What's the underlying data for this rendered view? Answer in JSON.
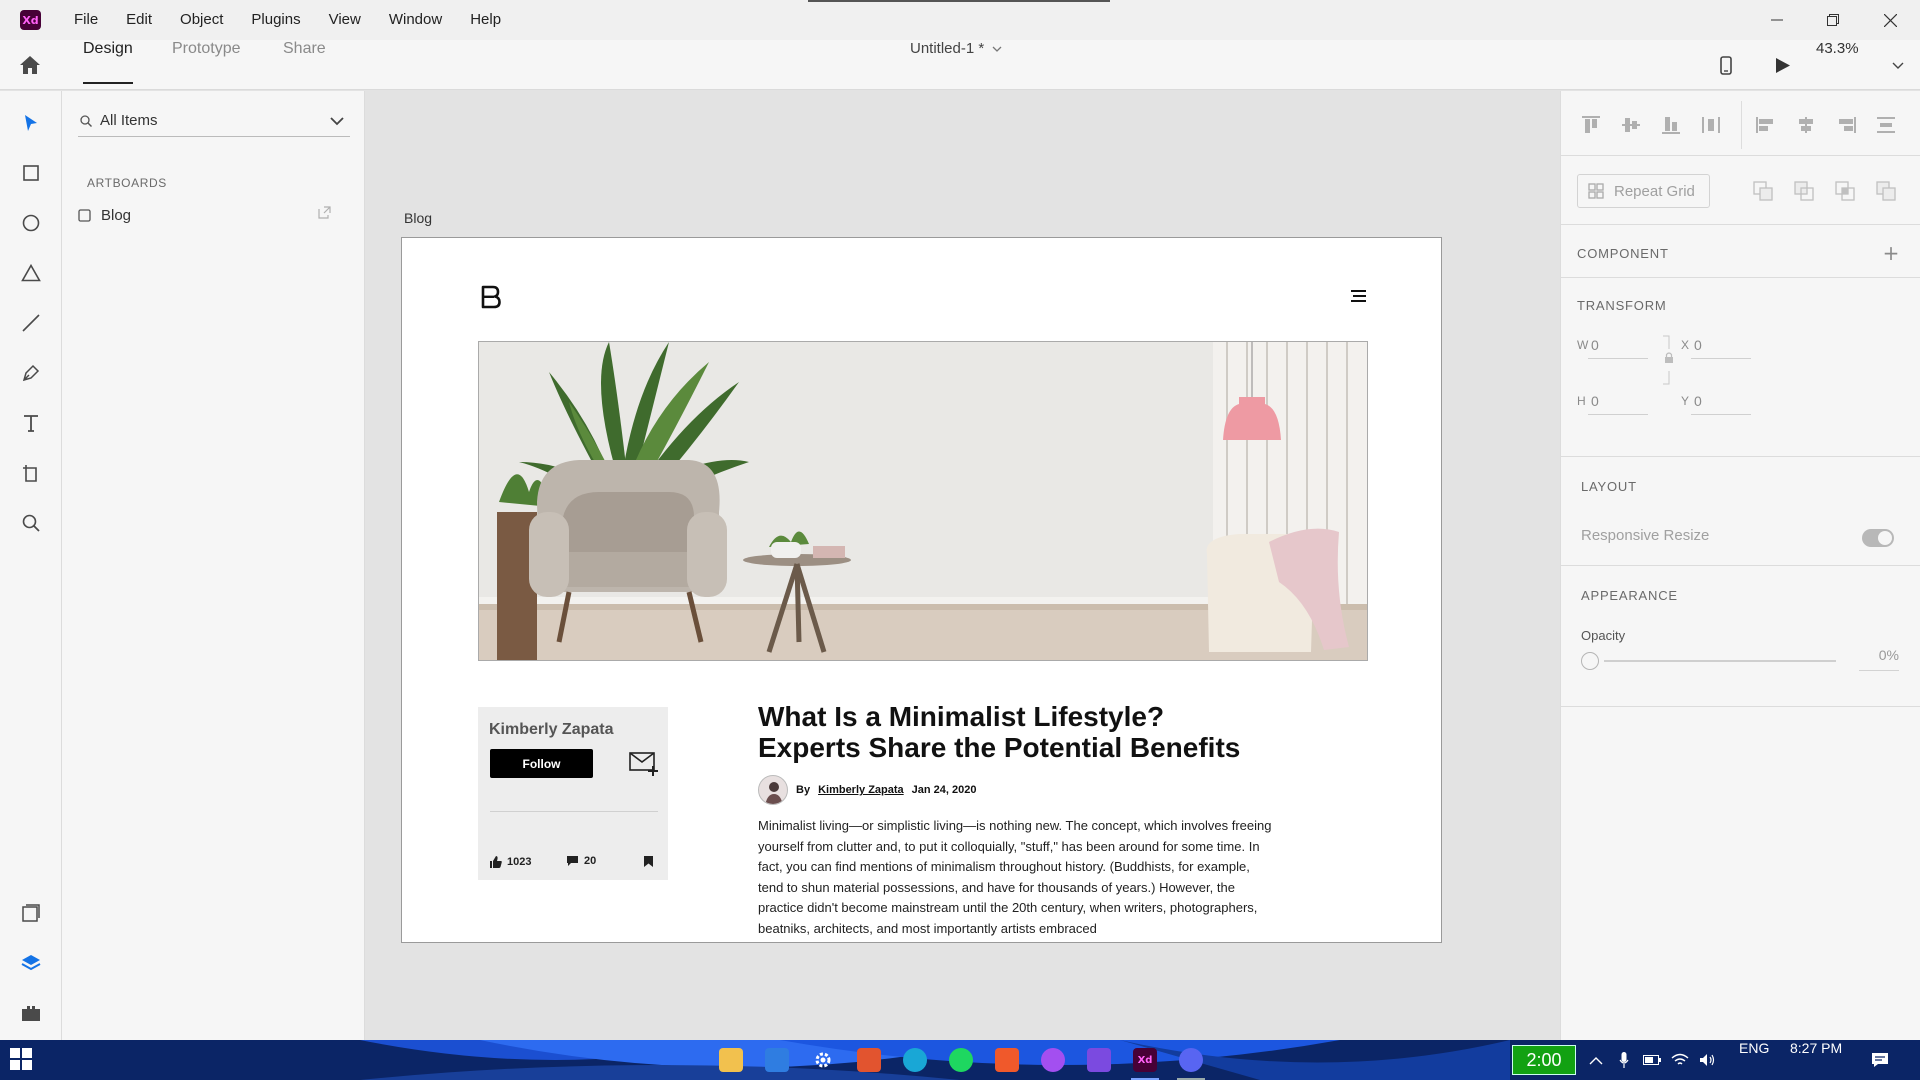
{
  "app": {
    "logo_text": "Xd",
    "brand_color": "#470137"
  },
  "menu": [
    "File",
    "Edit",
    "Object",
    "Plugins",
    "View",
    "Window",
    "Help"
  ],
  "modes": {
    "design": "Design",
    "prototype": "Prototype",
    "share": "Share"
  },
  "document": {
    "title": "Untitled-1 *",
    "zoom": "43.3%"
  },
  "layers": {
    "search_label": "All Items",
    "section": "ARTBOARDS",
    "artboards": [
      {
        "label": "Blog"
      }
    ]
  },
  "artboard": {
    "name": "Blog",
    "author_card": {
      "name": "Kimberly Zapata",
      "follow_label": "Follow",
      "likes": "1023",
      "comments": "20"
    },
    "article": {
      "headline_line1": "What Is a Minimalist Lifestyle?",
      "headline_line2": "Experts Share the Potential Benefits",
      "by": "By",
      "author": "Kimberly Zapata",
      "date": "Jan 24, 2020",
      "body": "Minimalist living—or simplistic living—is nothing new. The concept, which involves freeing yourself from clutter and, to put it colloquially, \"stuff,\" has been around for some time. In fact, you can find mentions of minimalism throughout history. (Buddhists, for example, tend to shun material possessions, and have for thousands of years.) However, the practice didn't become mainstream until the 20th century, when writers, photographers, beatniks, architects, and most importantly artists embraced"
    }
  },
  "inspector": {
    "repeat_grid": "Repeat Grid",
    "component": "COMPONENT",
    "transform": "TRANSFORM",
    "w_label": "W",
    "w_value": "0",
    "h_label": "H",
    "h_value": "0",
    "x_label": "X",
    "x_value": "0",
    "y_label": "Y",
    "y_value": "0",
    "layout": "LAYOUT",
    "responsive_resize": "Responsive Resize",
    "appearance": "APPEARANCE",
    "opacity_label": "Opacity",
    "opacity_value": "0%"
  },
  "taskbar": {
    "timer": "2:00",
    "language": "ENG",
    "clock": "8:27 PM"
  }
}
